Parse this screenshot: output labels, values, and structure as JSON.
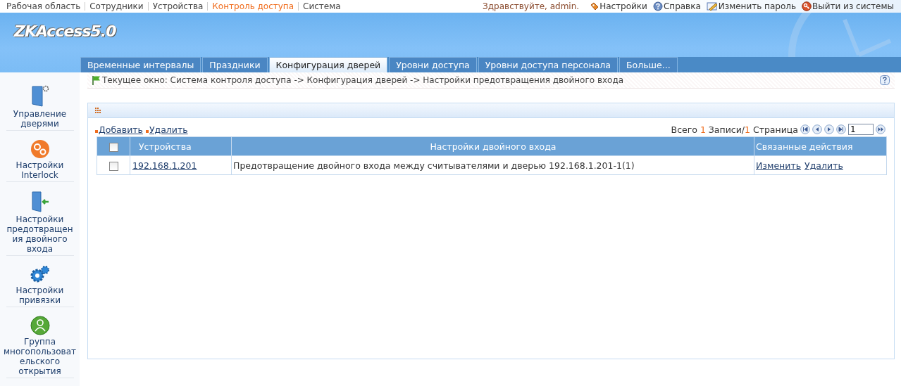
{
  "top_menu": [
    {
      "label": "Рабочая область",
      "selected": false
    },
    {
      "label": "Сотрудники",
      "selected": false
    },
    {
      "label": "Устройства",
      "selected": false
    },
    {
      "label": "Контроль доступа",
      "selected": true
    },
    {
      "label": "Система",
      "selected": false
    }
  ],
  "greeting": "Здравствуйте, admin.",
  "user_links": [
    {
      "kind": "settings",
      "label": "Настройки"
    },
    {
      "kind": "help",
      "label": "Справка"
    },
    {
      "kind": "password",
      "label": "Изменить пароль"
    },
    {
      "kind": "logout",
      "label": "Выйти из системы"
    }
  ],
  "logo": "ZKAccess5.0",
  "tabs": [
    {
      "label": "Временные интервалы",
      "selected": false
    },
    {
      "label": "Праздники",
      "selected": false
    },
    {
      "label": "Конфигурация дверей",
      "selected": true
    },
    {
      "label": "Уровни доступа",
      "selected": false
    },
    {
      "label": "Уровни доступа персонала",
      "selected": false
    },
    {
      "label": "Больше...",
      "selected": false
    }
  ],
  "sidebar": {
    "items": [
      {
        "kind": "door",
        "lines": [
          "Управление",
          "дверями"
        ]
      },
      {
        "kind": "interlock",
        "lines": [
          "Настройки",
          "Interlock"
        ]
      },
      {
        "kind": "antipassback",
        "lines": [
          "Настройки",
          "предотвращен",
          "ия двойного",
          "входа"
        ]
      },
      {
        "kind": "linkage",
        "lines": [
          "Настройки",
          "привязки"
        ]
      },
      {
        "kind": "group",
        "lines": [
          "Группа",
          "многопользоват",
          "ельского",
          "открытия"
        ]
      }
    ]
  },
  "breadcrumb": "Текущее окно: Система контроля доступа -> Конфигурация дверей -> Настройки предотвращения двойного входа",
  "actions": [
    "Добавить",
    "Удалить"
  ],
  "pager": {
    "total_label": "Всего",
    "total": "1",
    "records_label": "Записи/",
    "pages": "1",
    "pages_label": "Страница",
    "page_value": "1"
  },
  "table": {
    "columns": [
      "Устройства",
      "Настройки двойного входа",
      "Связанные действия"
    ],
    "select_all": false,
    "rows": [
      {
        "checked": false,
        "device": "192.168.1.201",
        "setting": "Предотвращение двойного входа между считывателями и дверью 192.168.1.201-1(1)",
        "actions": [
          "Изменить",
          "Удалить"
        ]
      }
    ]
  }
}
